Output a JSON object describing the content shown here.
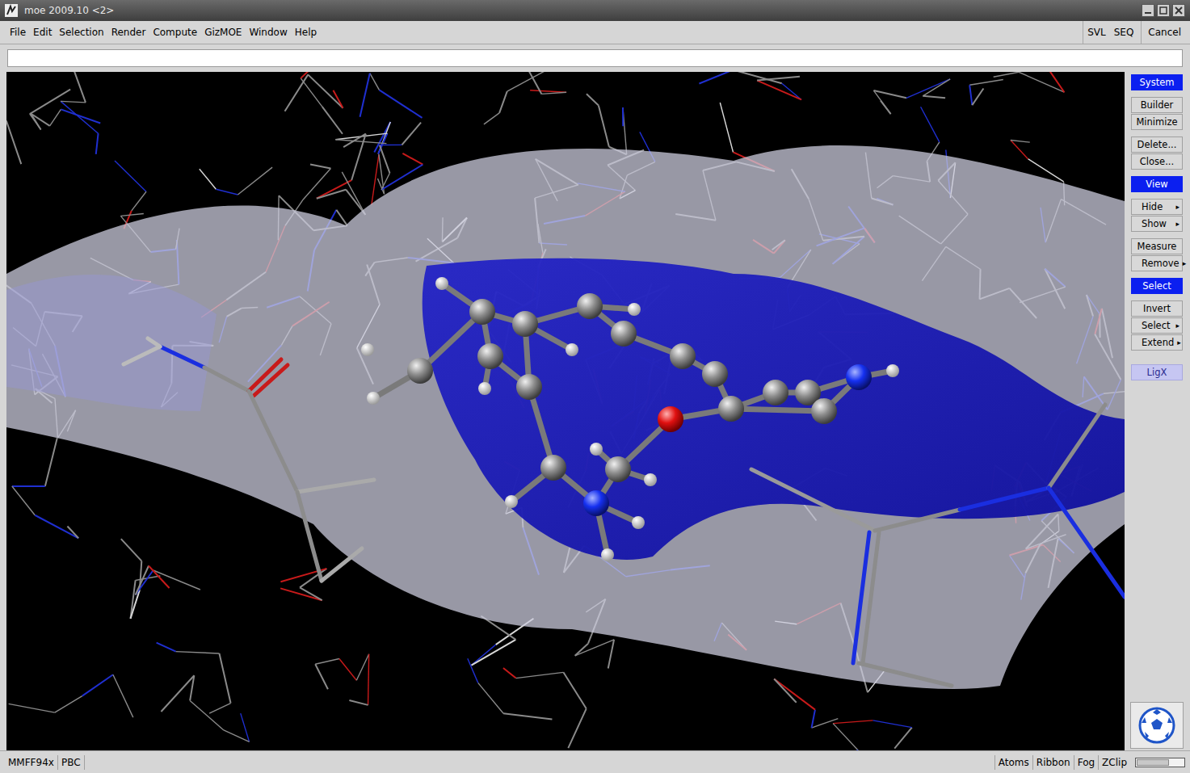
{
  "window": {
    "title": "moe 2009.10 <2>"
  },
  "menu": [
    "File",
    "Edit",
    "Selection",
    "Render",
    "Compute",
    "GizMOE",
    "Window",
    "Help"
  ],
  "menu_right": [
    "SVL",
    "SEQ",
    "Cancel"
  ],
  "command_line": {
    "value": ""
  },
  "side_panel": {
    "groups": [
      [
        {
          "label": "System",
          "kind": "header",
          "arrow": ""
        }
      ],
      [
        {
          "label": "Builder",
          "kind": "button",
          "arrow": ""
        },
        {
          "label": "Minimize",
          "kind": "button",
          "arrow": ""
        }
      ],
      [
        {
          "label": "Delete...",
          "kind": "button",
          "arrow": ""
        },
        {
          "label": "Close...",
          "kind": "button",
          "arrow": ""
        }
      ],
      [
        {
          "label": "View",
          "kind": "header",
          "arrow": ""
        }
      ],
      [
        {
          "label": "Hide",
          "kind": "menu",
          "arrow": "▸"
        },
        {
          "label": "Show",
          "kind": "menu",
          "arrow": "▸"
        }
      ],
      [
        {
          "label": "Measure",
          "kind": "button",
          "arrow": ""
        },
        {
          "label": "Remove",
          "kind": "menu",
          "arrow": "▸"
        }
      ],
      [
        {
          "label": "Select",
          "kind": "header",
          "arrow": ""
        }
      ],
      [
        {
          "label": "Invert",
          "kind": "button",
          "arrow": ""
        },
        {
          "label": "Select",
          "kind": "menu",
          "arrow": "▸"
        },
        {
          "label": "Extend",
          "kind": "menu",
          "arrow": "▸"
        }
      ],
      [
        {
          "label": "LigX",
          "kind": "accent",
          "arrow": ""
        }
      ]
    ]
  },
  "status_bar": {
    "left": [
      "MMFF94x",
      "PBC"
    ],
    "right": [
      "Atoms",
      "Ribbon",
      "Fog",
      "ZClip"
    ]
  }
}
